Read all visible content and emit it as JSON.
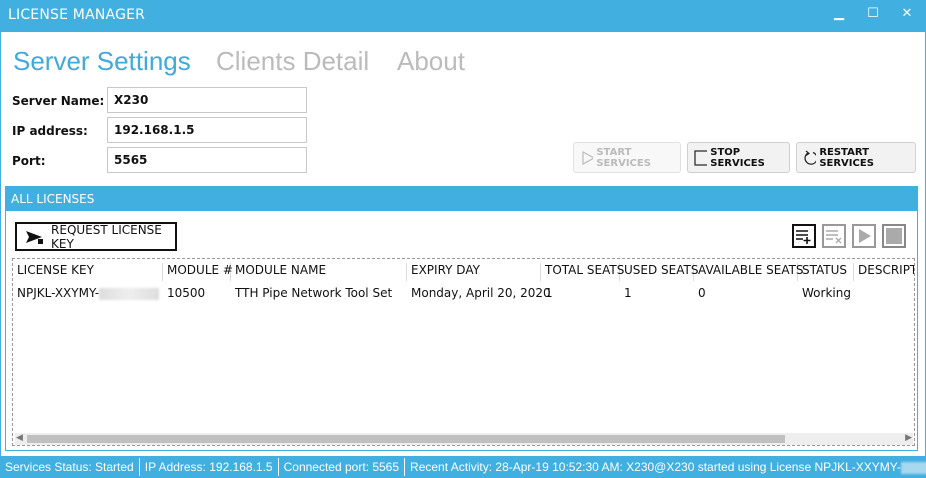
{
  "window": {
    "title": "LICENSE MANAGER",
    "minimize": "▁",
    "maximize": "☐",
    "close": "✕"
  },
  "tabs": [
    {
      "label": "Server Settings",
      "active": true
    },
    {
      "label": "Clients Detail"
    },
    {
      "label": "About"
    }
  ],
  "form": {
    "server_name_label": "Server Name:",
    "server_name": "X230",
    "ip_label": "IP address:",
    "ip": "192.168.1.5",
    "port_label": "Port:",
    "port": "5565"
  },
  "services": {
    "start": "START SERVICES",
    "stop": "STOP SERVICES",
    "restart": "RESTART SERVICES"
  },
  "panel": {
    "title": "ALL LICENSES",
    "request_button": "REQUEST LICENSE KEY"
  },
  "table": {
    "columns": [
      "LICENSE KEY",
      "MODULE #",
      "MODULE NAME",
      "EXPIRY DAY",
      "TOTAL SEATS",
      "USED SEATS",
      "AVAILABLE SEATS",
      "STATUS",
      "DESCRIPTI"
    ],
    "rows": [
      [
        "NPJKL-XXYMY-",
        "10500",
        "TTH Pipe Network Tool Set",
        "Monday, April 20, 2020",
        "1",
        "1",
        "0",
        "Working",
        ""
      ]
    ]
  },
  "status": {
    "services": "Services Status:  Started",
    "ip": "IP Address:  192.168.1.5",
    "port": "Connected port:  5565",
    "activity": "Recent Activity:  28-Apr-19 10:52:30 AM: X230@X230 started using License NPJKL-XXYMY-"
  },
  "colors": {
    "accent": "#41afe0"
  }
}
